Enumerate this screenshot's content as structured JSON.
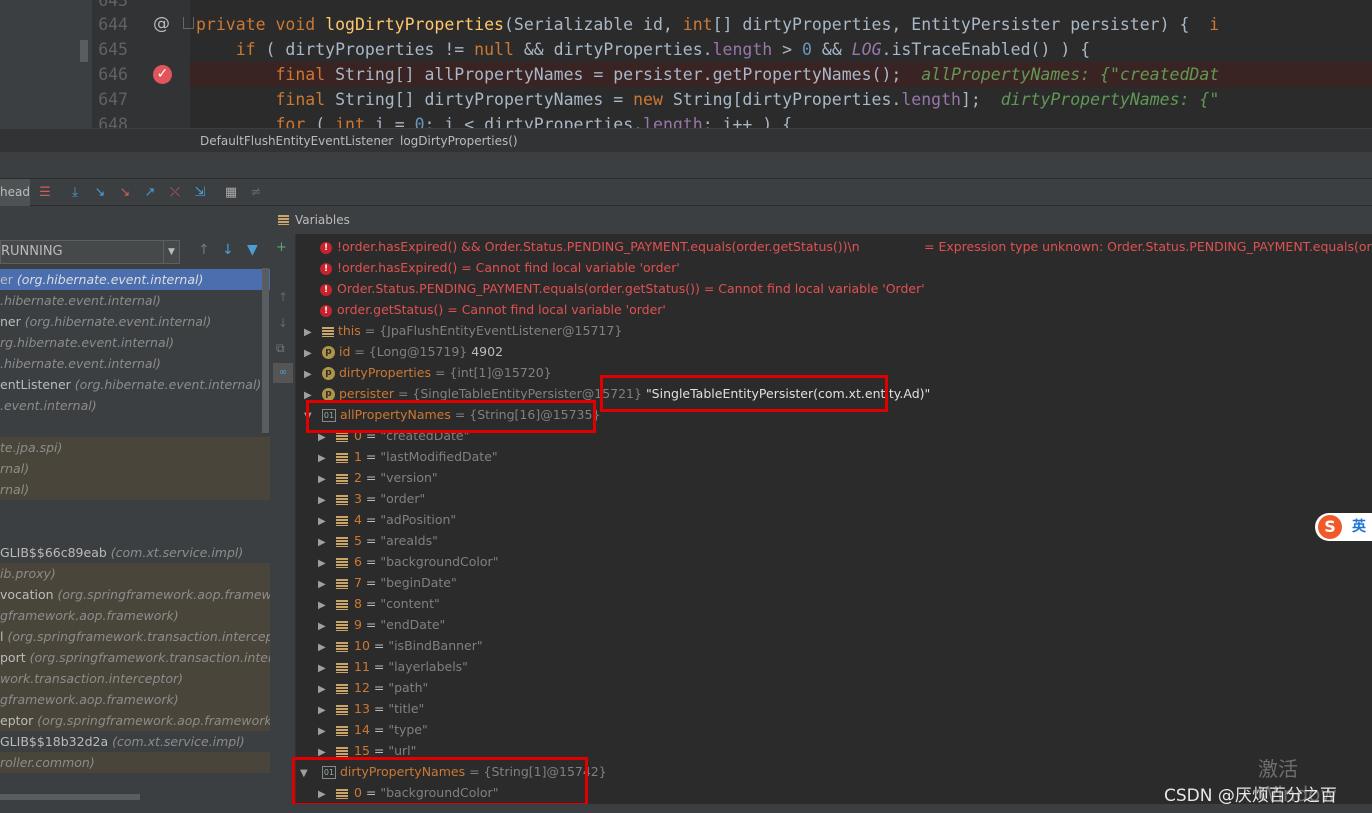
{
  "editor": {
    "lines": [
      {
        "num": "643",
        "kind": "partial-top"
      },
      {
        "num": "644",
        "text_parts": [
          [
            "kw",
            "private void "
          ],
          [
            "fn",
            "logDirtyProperties"
          ],
          [
            "",
            "(Serializable id, "
          ],
          [
            "kw",
            "int"
          ],
          [
            "",
            "[] dirtyProperties, EntityPersister persister) {  "
          ],
          [
            "kw",
            "i"
          ]
        ]
      },
      {
        "num": "645",
        "text_parts": [
          [
            "",
            "    "
          ],
          [
            "kw",
            "if"
          ],
          [
            "",
            " ( dirtyProperties != "
          ],
          [
            "kw",
            "null"
          ],
          [
            "",
            " && dirtyProperties."
          ],
          [
            "fd",
            "length"
          ],
          [
            "",
            " > "
          ],
          [
            "nm",
            "0"
          ],
          [
            "",
            " && "
          ],
          [
            "it",
            "LOG"
          ],
          [
            "",
            ".isTraceEnabled() ) {"
          ]
        ]
      },
      {
        "num": "646",
        "text_parts": [
          [
            "",
            "        "
          ],
          [
            "kw",
            "final "
          ],
          [
            "",
            "String[] allPropertyNames = persister.getPropertyNames();  "
          ],
          [
            "hint",
            "allPropertyNames: {\"createdDat"
          ]
        ]
      },
      {
        "num": "647",
        "text_parts": [
          [
            "",
            "        "
          ],
          [
            "kw",
            "final "
          ],
          [
            "",
            "String[] dirtyPropertyNames = "
          ],
          [
            "kw",
            "new "
          ],
          [
            "",
            "String[dirtyProperties."
          ],
          [
            "fd",
            "length"
          ],
          [
            "",
            "];  "
          ],
          [
            "hint",
            "dirtyPropertyNames: {\""
          ]
        ]
      },
      {
        "num": "648",
        "text_parts": [
          [
            "",
            "        "
          ],
          [
            "kw",
            "for"
          ],
          [
            "",
            " ( "
          ],
          [
            "kw",
            "int"
          ],
          [
            "",
            " i = "
          ],
          [
            "nm",
            "0"
          ],
          [
            "",
            "; i < dirtyProperties."
          ],
          [
            "fd",
            "length"
          ],
          [
            "",
            "; i++ ) {"
          ]
        ]
      }
    ],
    "gutter_icons": {
      "line644": "@",
      "line646": "breakpoint-check-icon"
    }
  },
  "breadcrumb": {
    "class": "DefaultFlushEntityEventListener",
    "method": "logDirtyProperties()"
  },
  "toolbar": {
    "thread_tab": "head"
  },
  "frames_panel": {
    "thread_status": "RUNNING",
    "frames": [
      {
        "method": "er ",
        "pkg": "(org.hibernate.event.internal)",
        "selected": true
      },
      {
        "method": "",
        "pkg": ".hibernate.event.internal)"
      },
      {
        "method": "ner ",
        "pkg": "(org.hibernate.event.internal)"
      },
      {
        "method": "",
        "pkg": "rg.hibernate.event.internal)"
      },
      {
        "method": "",
        "pkg": ".hibernate.event.internal)"
      },
      {
        "method": "entListener ",
        "pkg": "(org.hibernate.event.internal)"
      },
      {
        "method": "",
        "pkg": ".event.internal)"
      },
      {
        "method": "",
        "pkg": ""
      },
      {
        "method": "",
        "pkg": "te.jpa.spi)",
        "lib": true
      },
      {
        "method": "",
        "pkg": "rnal)",
        "lib": true
      },
      {
        "method": "",
        "pkg": "rnal)",
        "lib": true
      },
      {
        "method": "",
        "pkg": ""
      },
      {
        "method": "",
        "pkg": ""
      },
      {
        "method": "GLIB$$66c89eab ",
        "pkg": "(com.xt.service.impl)"
      },
      {
        "method": "",
        "pkg": "ib.proxy)",
        "lib": true
      },
      {
        "method": "vocation ",
        "pkg": "(org.springframework.aop.framework",
        "lib": true
      },
      {
        "method": "",
        "pkg": "gframework.aop.framework)",
        "lib": true
      },
      {
        "method": "l ",
        "pkg": "(org.springframework.transaction.interceptor",
        "lib": true
      },
      {
        "method": "port ",
        "pkg": "(org.springframework.transaction.intercep",
        "lib": true
      },
      {
        "method": "",
        "pkg": "work.transaction.interceptor)",
        "lib": true
      },
      {
        "method": "",
        "pkg": "gframework.aop.framework)",
        "lib": true
      },
      {
        "method": "eptor ",
        "pkg": "(org.springframework.aop.framework)",
        "lib": true
      },
      {
        "method": "GLIB$$18b32d2a ",
        "pkg": "(com.xt.service.impl)"
      },
      {
        "method": "",
        "pkg": "roller.common)",
        "lib": true
      }
    ]
  },
  "variables_panel": {
    "title": "Variables",
    "watches": [
      {
        "expr": "!order.hasExpired() && Order.Status.PENDING_PAYMENT.equals(order.getStatus())\\n",
        "result": "= Expression type unknown: Order.Status.PENDING_PAYMENT.equals(order.g"
      },
      {
        "expr": "!order.hasExpired()",
        "result": " = Cannot find local variable 'order'"
      },
      {
        "expr": "Order.Status.PENDING_PAYMENT.equals(order.getStatus())",
        "result": " = Cannot find local variable 'Order'"
      },
      {
        "expr": "order.getStatus()",
        "result": " = Cannot find local variable 'order'"
      }
    ],
    "this": {
      "name": "this",
      "value": " = {JpaFlushEntityEventListener@15717}"
    },
    "id": {
      "name": "id",
      "value": " = {Long@15719} ",
      "extra": "4902"
    },
    "dirtyProperties": {
      "name": "dirtyProperties",
      "value": " = {int[1]@15720}"
    },
    "persister": {
      "name": "persister",
      "value": " = {SingleTableEntityPersister@15721} ",
      "extra": "\"SingleTableEntityPersister(com.xt.entity.Ad)\""
    },
    "allPropertyNames": {
      "name": "allPropertyNames",
      "value": " = {String[16]@15735}"
    },
    "items": [
      {
        "idx": "0",
        "val": "\"createdDate\""
      },
      {
        "idx": "1",
        "val": "\"lastModifiedDate\""
      },
      {
        "idx": "2",
        "val": "\"version\""
      },
      {
        "idx": "3",
        "val": "\"order\""
      },
      {
        "idx": "4",
        "val": "\"adPosition\""
      },
      {
        "idx": "5",
        "val": "\"areaIds\""
      },
      {
        "idx": "6",
        "val": "\"backgroundColor\""
      },
      {
        "idx": "7",
        "val": "\"beginDate\""
      },
      {
        "idx": "8",
        "val": "\"content\""
      },
      {
        "idx": "9",
        "val": "\"endDate\""
      },
      {
        "idx": "10",
        "val": "\"isBindBanner\""
      },
      {
        "idx": "11",
        "val": "\"layerlabels\""
      },
      {
        "idx": "12",
        "val": "\"path\""
      },
      {
        "idx": "13",
        "val": "\"title\""
      },
      {
        "idx": "14",
        "val": "\"type\""
      },
      {
        "idx": "15",
        "val": "\"url\""
      }
    ],
    "dirtyPropertyNames": {
      "name": "dirtyPropertyNames",
      "value": " = {String[1]@15742}"
    },
    "dirty_items": [
      {
        "idx": "0",
        "val": "\"backgroundColor\""
      }
    ]
  },
  "overlay": {
    "windows_watermark": "激活 Window",
    "csdn": "CSDN @厌烦百分之百",
    "ime": "英"
  }
}
